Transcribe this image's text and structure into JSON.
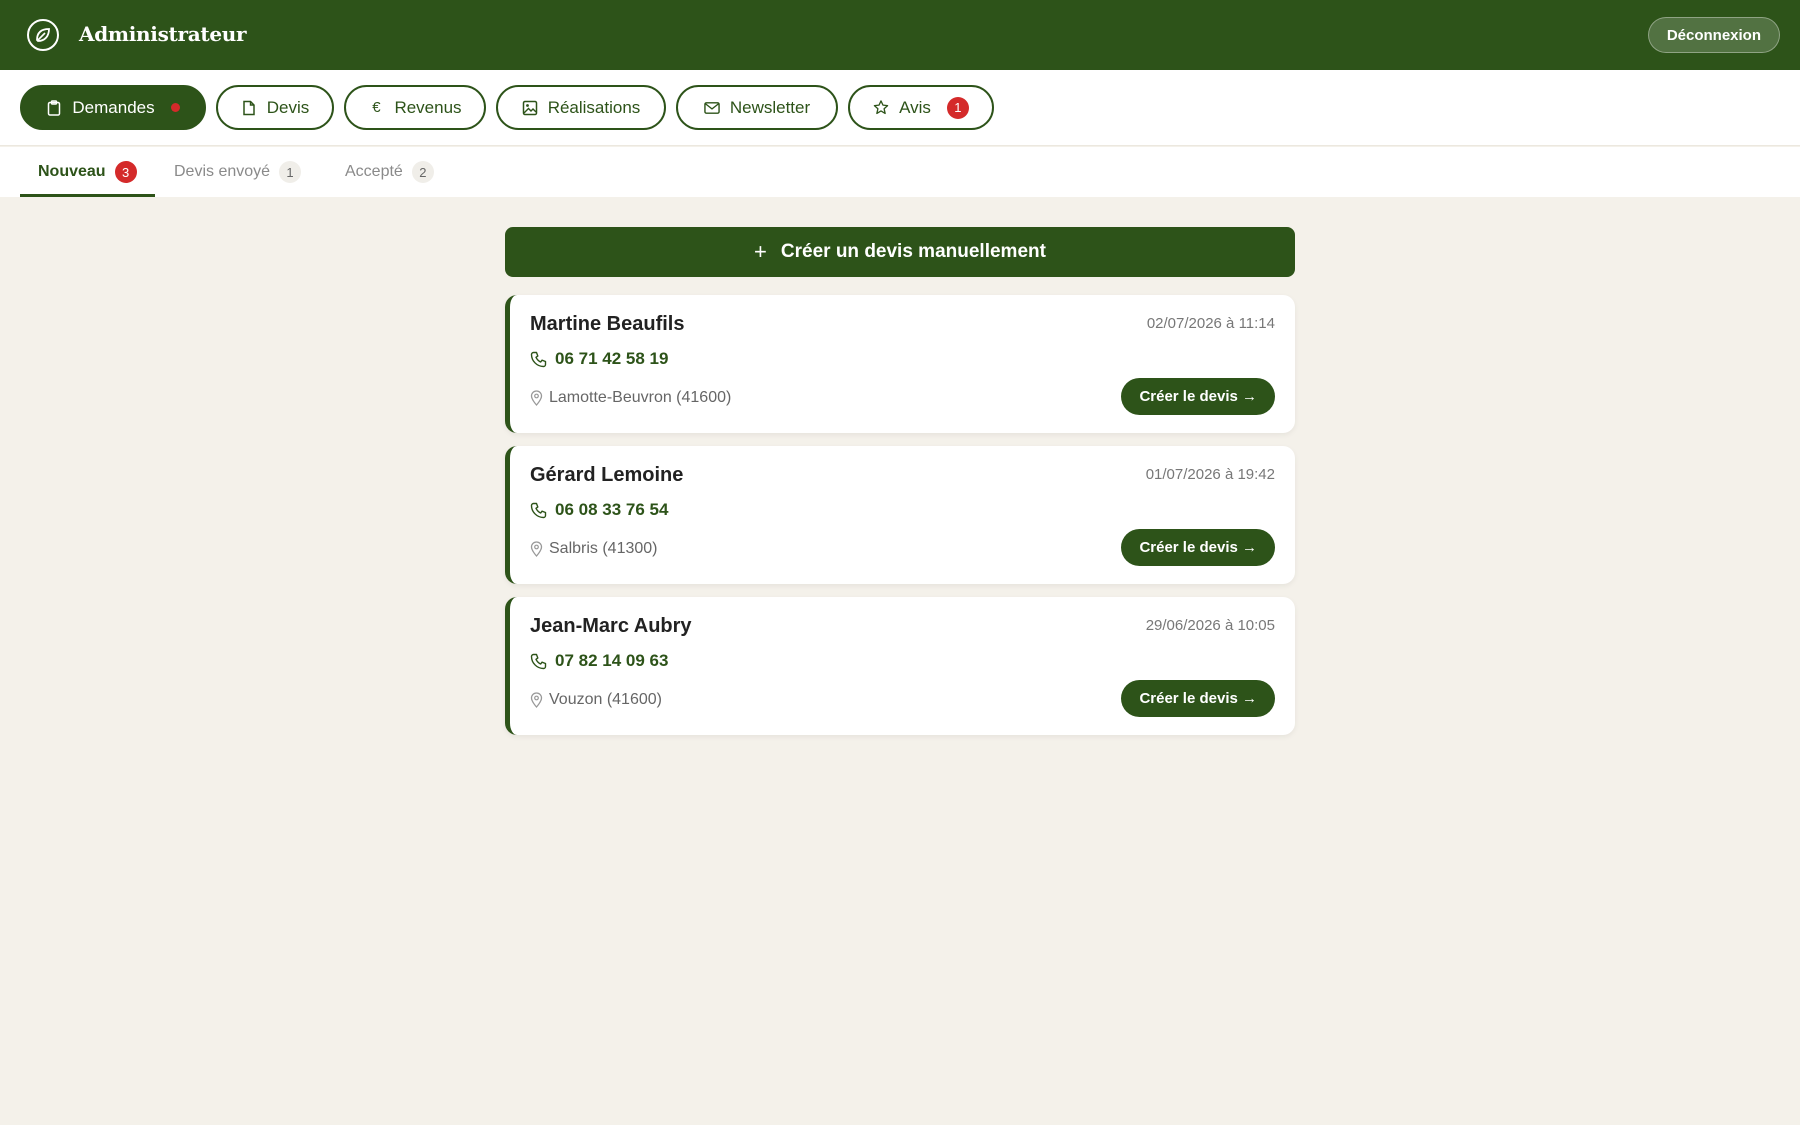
{
  "header": {
    "title": "Administrateur",
    "logout_label": "Déconnexion"
  },
  "nav": {
    "pills": [
      {
        "label": "Demandes",
        "icon": "clipboard-icon",
        "active": true,
        "indicator": "dot"
      },
      {
        "label": "Devis",
        "icon": "document-icon",
        "active": false
      },
      {
        "label": "Revenus",
        "icon": "euro-icon",
        "icon_glyph": "€",
        "active": false
      },
      {
        "label": "Réalisations",
        "icon": "image-icon",
        "active": false
      },
      {
        "label": "Newsletter",
        "icon": "mail-icon",
        "active": false
      },
      {
        "label": "Avis",
        "icon": "star-icon",
        "active": false,
        "badge": "1"
      }
    ]
  },
  "subtabs": [
    {
      "label": "Nouveau",
      "count": "3",
      "active": true
    },
    {
      "label": "Devis envoyé",
      "count": "1",
      "active": false
    },
    {
      "label": "Accepté",
      "count": "2",
      "active": false
    }
  ],
  "main": {
    "create_label": "Créer un devis manuellement",
    "create_icon": "+",
    "requests": [
      {
        "name": "Martine Beaufils",
        "date": "02/07/2026 à 11:14",
        "phone": "06 71 42 58 19",
        "location": "Lamotte-Beuvron (41600)",
        "cta_label": "Créer le devis →"
      },
      {
        "name": "Gérard Lemoine",
        "date": "01/07/2026 à 19:42",
        "phone": "06 08 33 76 54",
        "location": "Salbris (41300)",
        "cta_label": "Créer le devis →"
      },
      {
        "name": "Jean-Marc Aubry",
        "date": "29/06/2026 à 10:05",
        "phone": "07 82 14 09 63",
        "location": "Vouzon (41600)",
        "cta_label": "Créer le devis →"
      }
    ]
  },
  "colors": {
    "brand_green": "#2d5319",
    "background": "#f4f1ea",
    "alert_red": "#d42a2a"
  }
}
